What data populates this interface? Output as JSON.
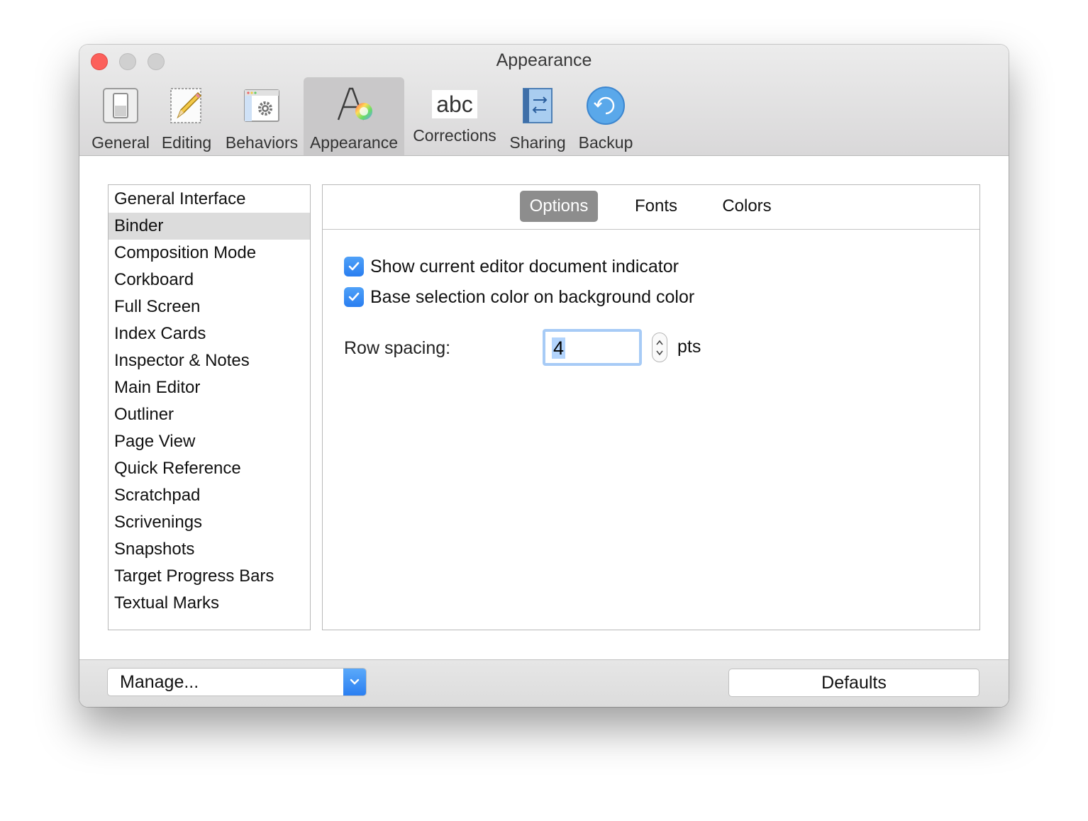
{
  "window": {
    "title": "Appearance"
  },
  "toolbar": {
    "items": [
      {
        "label": "General",
        "icon": "general-switch-icon"
      },
      {
        "label": "Editing",
        "icon": "pencil-icon"
      },
      {
        "label": "Behaviors",
        "icon": "gear-window-icon"
      },
      {
        "label": "Appearance",
        "icon": "font-color-icon",
        "selected": true
      },
      {
        "label": "Corrections",
        "icon": "abc-icon"
      },
      {
        "label": "Sharing",
        "icon": "sharing-arrows-icon"
      },
      {
        "label": "Backup",
        "icon": "backup-clock-icon"
      }
    ],
    "abc_glyph": "abc"
  },
  "sidebar": {
    "selected": "Binder",
    "items": [
      "General Interface",
      "Binder",
      "Composition Mode",
      "Corkboard",
      "Full Screen",
      "Index Cards",
      "Inspector & Notes",
      "Main Editor",
      "Outliner",
      "Page View",
      "Quick Reference",
      "Scratchpad",
      "Scrivenings",
      "Snapshots",
      "Target Progress Bars",
      "Textual Marks"
    ]
  },
  "tabs": {
    "items": [
      "Options",
      "Fonts",
      "Colors"
    ],
    "selected": "Options"
  },
  "options": {
    "show_indicator": {
      "label": "Show current editor document indicator",
      "checked": true
    },
    "base_selection": {
      "label": "Base selection color on background color",
      "checked": true
    },
    "row_spacing": {
      "label": "Row spacing:",
      "value": "4",
      "units": "pts"
    }
  },
  "footer": {
    "manage_label": "Manage...",
    "defaults_label": "Defaults"
  },
  "colors": {
    "accent": "#2a7ef0",
    "close_button": "#fc605b",
    "selected_tab": "#8d8d8d"
  }
}
